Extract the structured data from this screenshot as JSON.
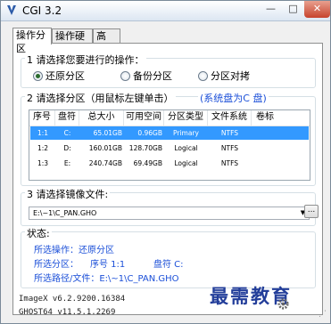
{
  "window": {
    "title": "CGI 3.2",
    "minimize": "—",
    "maximize": "□",
    "close": "✕"
  },
  "tabs": [
    {
      "label": "操作分区",
      "active": true
    },
    {
      "label": "操作硬盘",
      "active": false
    },
    {
      "label": "高 级",
      "active": false
    }
  ],
  "operation": {
    "label": "1 请选择您要进行的操作：",
    "options": [
      {
        "label": "还原分区",
        "selected": true
      },
      {
        "label": "备份分区",
        "selected": false
      },
      {
        "label": "分区对拷",
        "selected": false
      }
    ]
  },
  "partition": {
    "label": "2 请选择分区（用鼠标左键单击）",
    "system_disk_note": "(系统盘为C 盘)",
    "columns": [
      "序号",
      "盘符",
      "总大小",
      "可用空间",
      "分区类型",
      "文件系统",
      "卷标"
    ],
    "rows": [
      {
        "num": "1:1",
        "drive": "C:",
        "total": "65.01GB",
        "free": "0.96GB",
        "type": "Primary",
        "fs": "NTFS",
        "label": "",
        "selected": true
      },
      {
        "num": "1:2",
        "drive": "D:",
        "total": "160.01GB",
        "free": "128.70GB",
        "type": "Logical",
        "fs": "NTFS",
        "label": "",
        "selected": false
      },
      {
        "num": "1:3",
        "drive": "E:",
        "total": "240.74GB",
        "free": "69.49GB",
        "type": "Logical",
        "fs": "NTFS",
        "label": "",
        "selected": false
      }
    ]
  },
  "image_file": {
    "label": "3 请选择镜像文件:",
    "value": "E:\\~1\\C_PAN.GHO",
    "browse": "..."
  },
  "status": {
    "label": "状态:",
    "operation": "所选操作：还原分区",
    "partition_prefix": "所选分区：",
    "partition_num": "序号 1:1",
    "partition_drive": "盘符 C:",
    "path": "所选路径/文件：E:\\~1\\C_PAN.GHO"
  },
  "footer": {
    "imagex": "ImageX v6.2.9200.16384",
    "ghost": "GHOST64 v11.5.1.2269"
  },
  "watermark": "最需教育"
}
